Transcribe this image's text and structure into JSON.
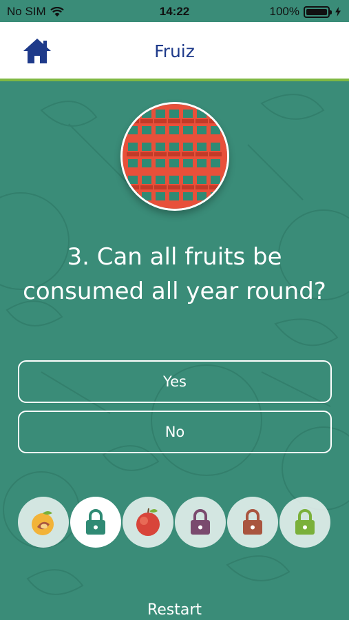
{
  "status_bar": {
    "carrier": "No SIM",
    "time": "14:22",
    "battery": "100%",
    "icons": [
      "wifi-icon",
      "battery-icon",
      "charging-icon"
    ]
  },
  "nav": {
    "title": "Fruiz",
    "home_icon": "home-icon"
  },
  "quiz": {
    "question": "3. Can all fruits be consumed all year round?",
    "answers": [
      "Yes",
      "No"
    ]
  },
  "progress": [
    {
      "icon": "peach-icon",
      "state": "unlocked"
    },
    {
      "icon": "lock-icon",
      "state": "current",
      "color": "#2f8a74"
    },
    {
      "icon": "apple-icon",
      "state": "unlocked"
    },
    {
      "icon": "lock-icon",
      "state": "locked",
      "color": "#7a4a6e"
    },
    {
      "icon": "lock-icon",
      "state": "locked",
      "color": "#a9553f"
    },
    {
      "icon": "lock-icon",
      "state": "locked",
      "color": "#7ab03a"
    }
  ],
  "footer": {
    "restart_label": "Restart"
  },
  "colors": {
    "background": "#3a8c78",
    "nav_accent": "#7fb842",
    "title": "#1e3a8a",
    "calendar": "#e8503a"
  }
}
